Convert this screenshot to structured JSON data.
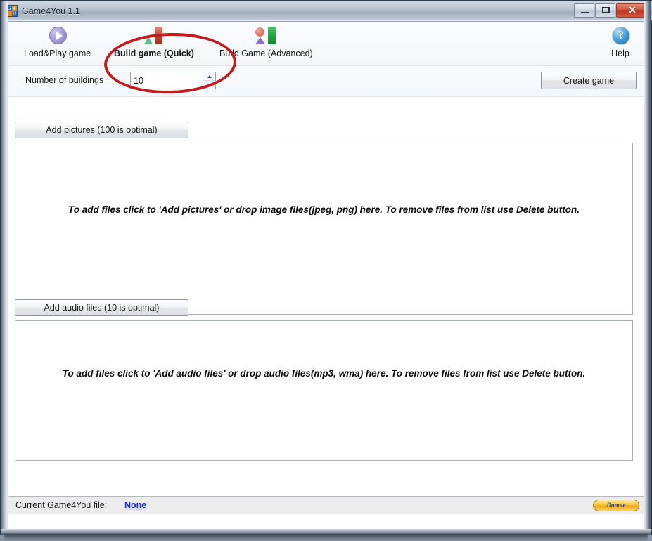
{
  "window": {
    "title": "Game4You 1.1",
    "app_icon": "game4you-icon",
    "icon_letters": {
      "q1": "G",
      "q2": "4",
      "q3": "",
      "q4": "U"
    },
    "controls": {
      "minimize": "minimize-button",
      "maximize": "maximize-button",
      "close_glyph": "✕"
    }
  },
  "toolbar": {
    "items": [
      {
        "label": "Load&Play game",
        "icon": "play-circle-icon",
        "active": false
      },
      {
        "label": "Build game (Quick)",
        "icon": "quick-build-icon",
        "active": true
      },
      {
        "label": "Build Game (Advanced)",
        "icon": "advanced-build-icon",
        "active": false
      }
    ],
    "help": {
      "label": "Help",
      "icon": "help-question-icon"
    }
  },
  "annotation": {
    "shape": "red-ellipse",
    "color": "#c31a1a",
    "targets": "Build game (Quick)"
  },
  "settings": {
    "buildings_label": "Number of buildings",
    "buildings_value": "10",
    "create_button": "Create game"
  },
  "pictures": {
    "add_button": "Add pictures (100 is optimal)",
    "dropzone_text": "To add files click to 'Add pictures' or drop image files(jpeg, png) here. To remove files from list use Delete button."
  },
  "audio": {
    "add_button": "Add audio files (10 is optimal)",
    "dropzone_text": "To add files click to 'Add audio files' or drop audio files(mp3, wma) here. To remove files from list use Delete button."
  },
  "statusbar": {
    "label": "Current Game4You file:",
    "file_link": "None",
    "donate_label": "Donate"
  },
  "colors": {
    "annotation_red": "#c31a1a",
    "link_blue": "#1b27d4",
    "close_red": "#b8341b",
    "donate_gold": "#f0a819"
  }
}
